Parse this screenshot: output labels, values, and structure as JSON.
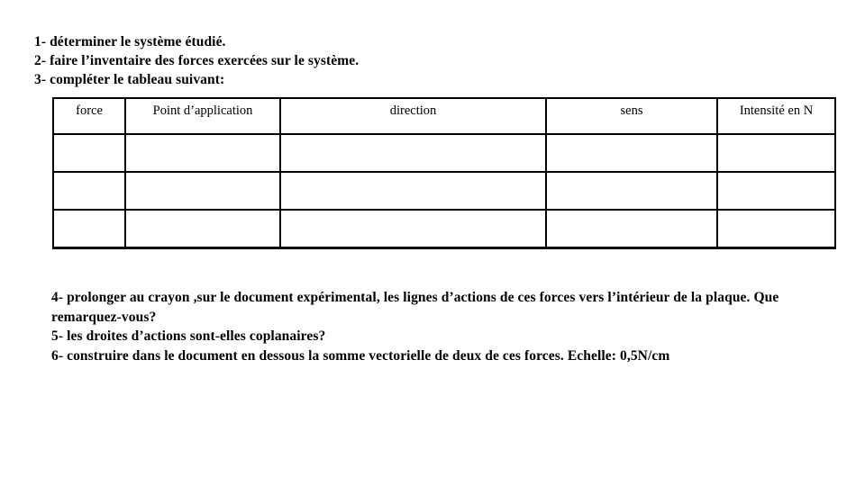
{
  "document": {
    "instructions": [
      "1- déterminer le système étudié.",
      "2- faire l’inventaire des forces exercées sur le système.",
      "3- compléter le tableau suivant:"
    ],
    "table": {
      "headers": [
        "force",
        "Point d’application",
        "direction",
        "sens",
        "Intensité en N"
      ],
      "rows": [
        [
          "",
          "",
          "",
          "",
          ""
        ],
        [
          "",
          "",
          "",
          "",
          ""
        ],
        [
          "",
          "",
          "",
          "",
          ""
        ]
      ]
    },
    "questions": [
      "4- prolonger au crayon ,sur le document expérimental, les lignes d’actions de ces forces vers l’intérieur de la plaque. Que remarquez-vous?",
      "5- les droites d’actions sont-elles coplanaires?",
      "6- construire dans le document en dessous la somme vectorielle de deux de ces forces. Echelle: 0,5N/cm"
    ]
  }
}
